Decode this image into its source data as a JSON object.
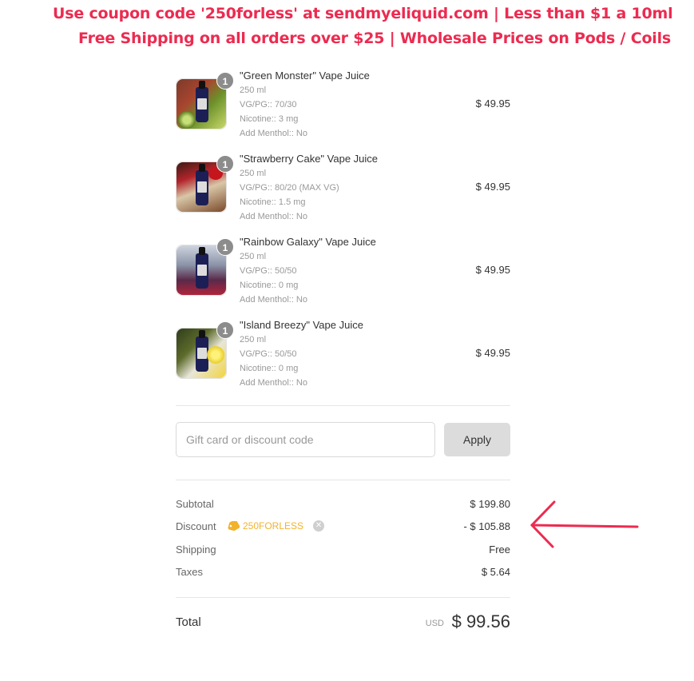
{
  "banner": {
    "line1": "Use coupon code '250forless' at sendmyeliquid.com | Less than $1 a 10ml",
    "line2": "Free Shipping on all orders over $25 | Wholesale Prices on Pods / Coils"
  },
  "items": [
    {
      "qty": "1",
      "name": "\"Green Monster\" Vape Juice",
      "size": "250 ml",
      "vgpg": "VG/PG:: 70/30",
      "nicotine": "Nicotine:: 3 mg",
      "menthol": "Add Menthol:: No",
      "price": "$ 49.95",
      "icon": "green-monster-product-image"
    },
    {
      "qty": "1",
      "name": "\"Strawberry Cake\" Vape Juice",
      "size": "250 ml",
      "vgpg": "VG/PG:: 80/20 (MAX VG)",
      "nicotine": "Nicotine:: 1.5 mg",
      "menthol": "Add Menthol:: No",
      "price": "$ 49.95",
      "icon": "strawberry-cake-product-image"
    },
    {
      "qty": "1",
      "name": "\"Rainbow Galaxy\" Vape Juice",
      "size": "250 ml",
      "vgpg": "VG/PG:: 50/50",
      "nicotine": "Nicotine:: 0 mg",
      "menthol": "Add Menthol:: No",
      "price": "$ 49.95",
      "icon": "rainbow-galaxy-product-image"
    },
    {
      "qty": "1",
      "name": "\"Island Breezy\" Vape Juice",
      "size": "250 ml",
      "vgpg": "VG/PG:: 50/50",
      "nicotine": "Nicotine:: 0 mg",
      "menthol": "Add Menthol:: No",
      "price": "$ 49.95",
      "icon": "island-breezy-product-image"
    }
  ],
  "discount": {
    "placeholder": "Gift card or discount code",
    "apply_label": "Apply"
  },
  "totals": {
    "subtotal_label": "Subtotal",
    "subtotal_value": "$ 199.80",
    "discount_label": "Discount",
    "discount_code": "250FORLESS",
    "discount_value": "- $ 105.88",
    "shipping_label": "Shipping",
    "shipping_value": "Free",
    "taxes_label": "Taxes",
    "taxes_value": "$ 5.64"
  },
  "total": {
    "label": "Total",
    "currency": "USD",
    "amount": "$ 99.56"
  },
  "colors": {
    "banner": "#ec2b50",
    "discount_tag": "#f2b22c",
    "arrow": "#ec2b50"
  }
}
